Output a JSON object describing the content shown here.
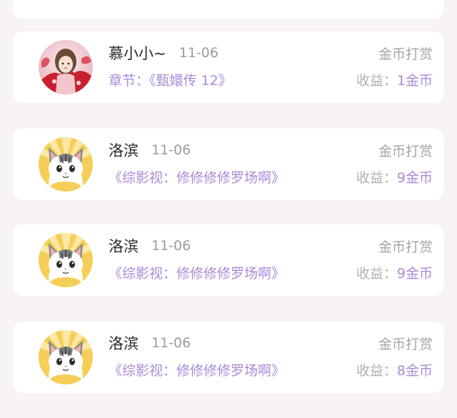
{
  "colors": {
    "background": "#f8f3f5",
    "card": "#ffffff",
    "accent_purple": "#a98ad8",
    "text_dark": "#2a2a2a",
    "text_gray": "#9c9c9c"
  },
  "records": [
    {
      "avatar_icon": "girl-red-robe-avatar",
      "name": "慕小小~",
      "date": "11-06",
      "chapter": "章节：《甄嬛传 12》",
      "tip_type": "金币打赏",
      "income_label": "收益：",
      "income_value": "1金币"
    },
    {
      "avatar_icon": "cat-avatar",
      "name": "洛滨",
      "date": "11-06",
      "chapter": "《综影视：修修修修罗场啊》",
      "tip_type": "金币打赏",
      "income_label": "收益：",
      "income_value": "9金币"
    },
    {
      "avatar_icon": "cat-avatar",
      "name": "洛滨",
      "date": "11-06",
      "chapter": "《综影视：修修修修罗场啊》",
      "tip_type": "金币打赏",
      "income_label": "收益：",
      "income_value": "9金币"
    },
    {
      "avatar_icon": "cat-avatar",
      "name": "洛滨",
      "date": "11-06",
      "chapter": "《综影视：修修修修罗场啊》",
      "tip_type": "金币打赏",
      "income_label": "收益：",
      "income_value": "8金币"
    }
  ]
}
